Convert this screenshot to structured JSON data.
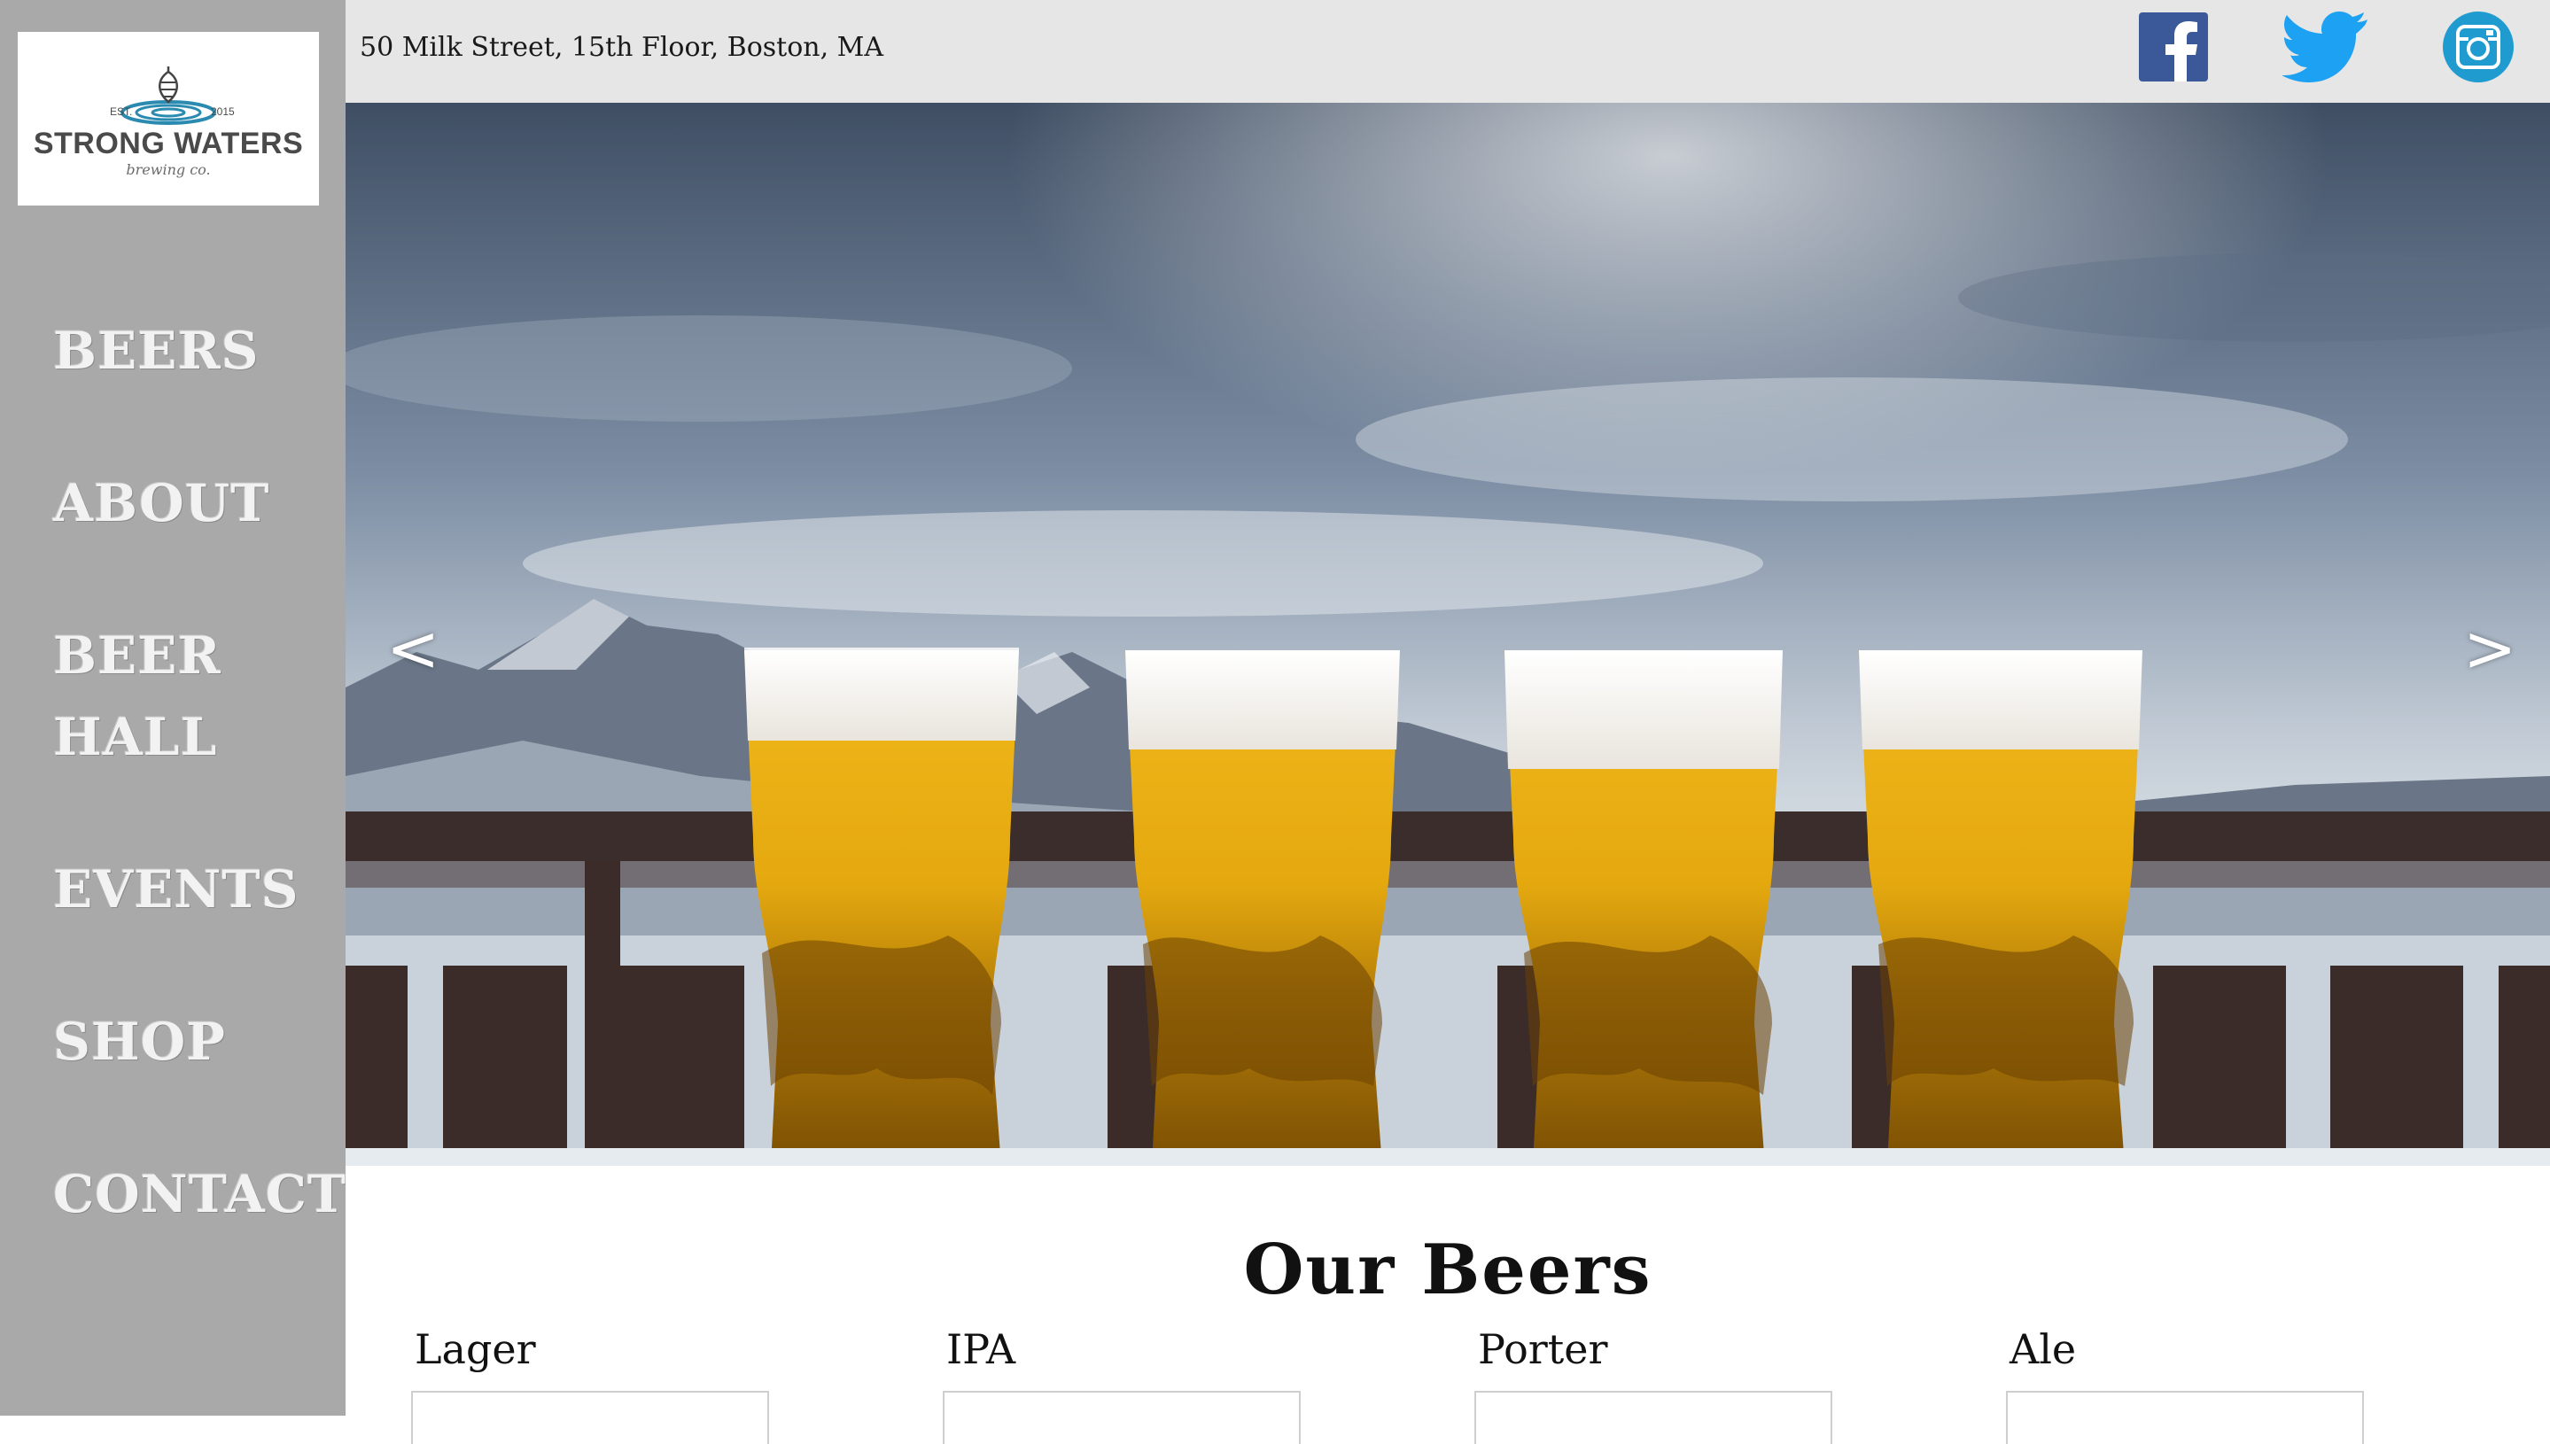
{
  "logo": {
    "est": "EST.",
    "year": "2015",
    "name": "STRONG WATERS",
    "sub": "brewing co."
  },
  "nav": {
    "items": [
      {
        "label": "BEERS"
      },
      {
        "label": "ABOUT"
      },
      {
        "label": "BEER HALL"
      },
      {
        "label": "EVENTS"
      },
      {
        "label": "SHOP"
      },
      {
        "label": "CONTACT"
      }
    ]
  },
  "topbar": {
    "address": "50 Milk Street, 15th Floor, Boston, MA"
  },
  "social": {
    "facebook": {
      "icon": "facebook-icon",
      "color": "#3b5998"
    },
    "twitter": {
      "icon": "twitter-icon",
      "color": "#1da1f2"
    },
    "instagram": {
      "icon": "instagram-icon",
      "color": "#1f9bd0"
    }
  },
  "carousel": {
    "prev_label": "<",
    "next_label": ">"
  },
  "beers": {
    "title": "Our Beers",
    "items": [
      {
        "name": "Lager"
      },
      {
        "name": "IPA"
      },
      {
        "name": "Porter"
      },
      {
        "name": "Ale"
      }
    ]
  }
}
